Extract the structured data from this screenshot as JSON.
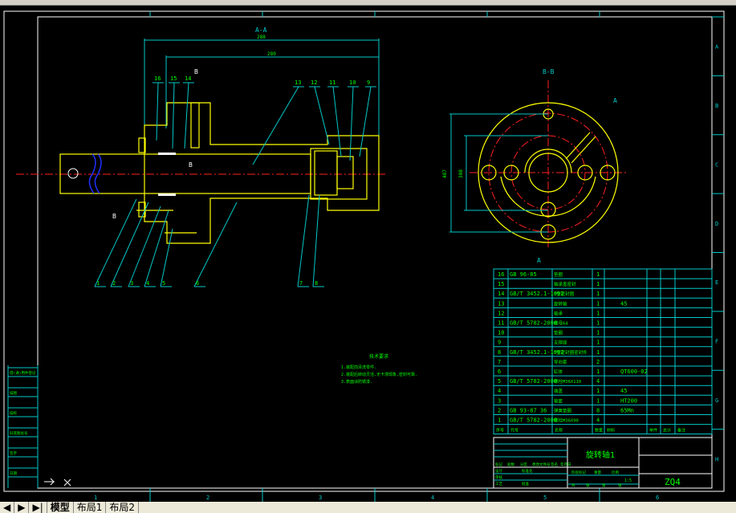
{
  "tabs": {
    "items": [
      "模型",
      "布局1",
      "布局2"
    ]
  },
  "zones": {
    "rows": [
      "A",
      "B",
      "C",
      "D",
      "E",
      "F",
      "G",
      "H"
    ],
    "cols": [
      "1",
      "2",
      "3",
      "4",
      "5",
      "6"
    ]
  },
  "section_aa": {
    "title": "A-A",
    "dim_overall": "288",
    "dim_inner": "280",
    "section_mark": "B",
    "balloons": [
      "16",
      "15",
      "14",
      "13",
      "12",
      "11",
      "10",
      "9",
      "1",
      "2",
      "3",
      "4",
      "5",
      "6",
      "7",
      "8"
    ]
  },
  "section_bb": {
    "title": "B-B",
    "dim_outer": "487",
    "dim_inner": "308",
    "section_mark": "A"
  },
  "notes": {
    "title": "技术要求",
    "lines": [
      "1.装配前清洗零件.",
      "2.装配后转动灵活,无卡滞现象,密封可靠.",
      "3.表面涂防锈漆."
    ]
  },
  "bom": {
    "rows": [
      [
        "16",
        "GB 96-85",
        "垫圈",
        "1",
        ""
      ],
      [
        "15",
        "",
        "轴承盖密封",
        "1",
        ""
      ],
      [
        "14",
        "GB/T 3452.1-1992",
        "O型密封圈",
        "1",
        ""
      ],
      [
        "13",
        "",
        "旋转轴",
        "1",
        "45"
      ],
      [
        "12",
        "",
        "轴承",
        "1",
        ""
      ],
      [
        "11",
        "GB/T 5782-2000",
        "螺母64",
        "1",
        ""
      ],
      [
        "10",
        "",
        "垫圈",
        "1",
        ""
      ],
      [
        "9",
        "",
        "支撑座",
        "1",
        ""
      ],
      [
        "8",
        "GB/T 3452.1-1992",
        "O型密封圈密封件",
        "1",
        ""
      ],
      [
        "7",
        "",
        "导向套",
        "2",
        ""
      ],
      [
        "6",
        "",
        "缸体",
        "1",
        "QT600-02"
      ],
      [
        "5",
        "GB/T 5782-2000",
        "螺栓M36X110",
        "4",
        ""
      ],
      [
        "4",
        "",
        "端盖",
        "1",
        "45"
      ],
      [
        "3",
        "",
        "轴套",
        "1",
        "HT200"
      ],
      [
        "2",
        "GB 93-87 36",
        "弹簧垫圈",
        "8",
        "65Mn"
      ],
      [
        "1",
        "GB/T 5782-2000",
        "螺栓M36X90",
        "4",
        ""
      ]
    ],
    "header": [
      "序号",
      "代号",
      "名称",
      "数量",
      "材料",
      "单件",
      "总计",
      "备注"
    ]
  },
  "title_block": {
    "name": "旋转轴1",
    "code": "ZQ4",
    "scale": "1:5",
    "labels": [
      "标记",
      "处数",
      "分区",
      "更改文件号",
      "签名",
      "年月日",
      "设计",
      "标准化",
      "审核",
      "工艺",
      "批准",
      "阶段标记",
      "重量",
      "比例",
      "共",
      "张",
      "第",
      "张"
    ]
  },
  "left_strip": {
    "items": [
      "借(通)用件登记",
      "描图",
      "描校",
      "旧底图总号",
      "签字",
      "日期"
    ]
  }
}
